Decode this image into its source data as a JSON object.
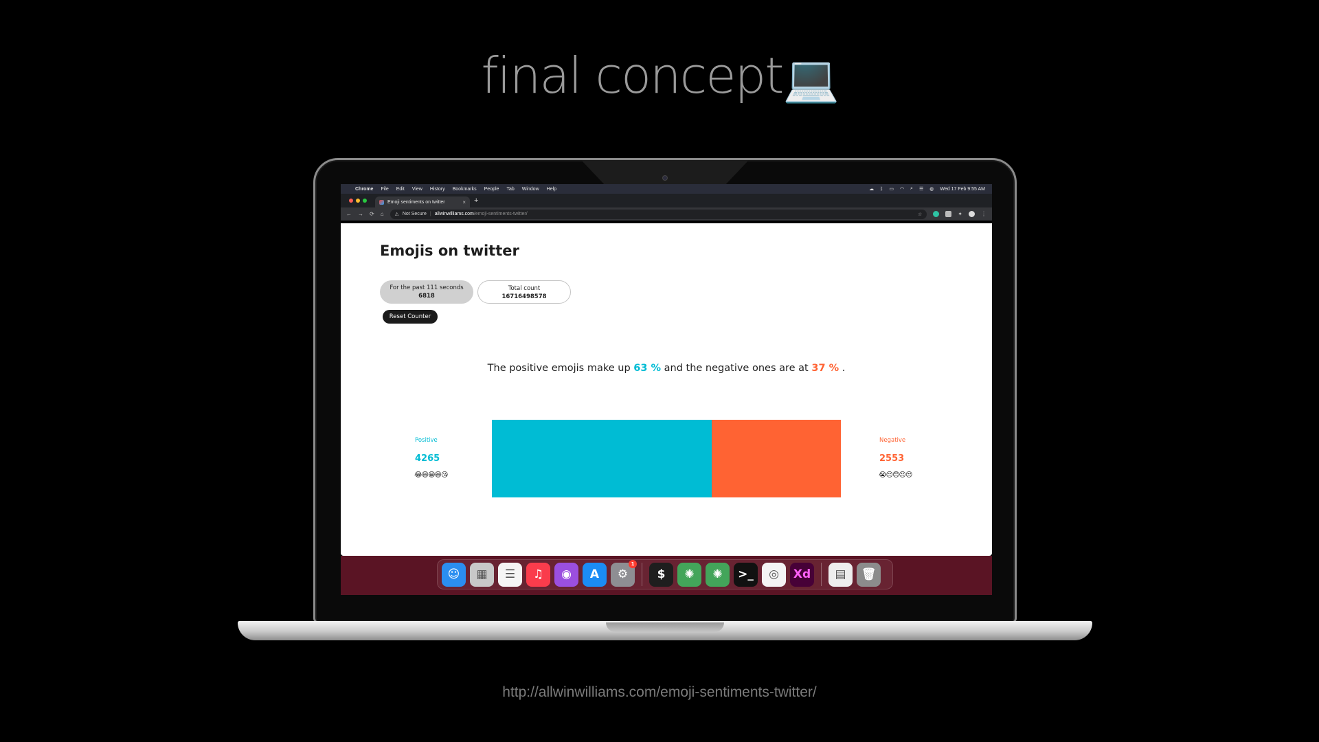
{
  "slide": {
    "title": "final concept",
    "title_emoji": "💻",
    "url": "http://allwinwilliams.com/emoji-sentiments-twitter/"
  },
  "menubar": {
    "apple": "",
    "app": "Chrome",
    "items": [
      "File",
      "Edit",
      "View",
      "History",
      "Bookmarks",
      "People",
      "Tab",
      "Window",
      "Help"
    ],
    "clock": "Wed 17 Feb  9:55 AM"
  },
  "browser": {
    "tab_title": "Emoji sentiments on twitter",
    "tab_close": "×",
    "new_tab": "+",
    "not_secure": "Not Secure",
    "url_host": "allwinwilliams.com",
    "url_path": "/emoji-sentiments-twitter/",
    "back": "←",
    "forward": "→",
    "reload": "⟳",
    "home": "⌂",
    "star": "☆",
    "menu": "⋮"
  },
  "page": {
    "title": "Emojis on twitter",
    "past": {
      "label": "For the past 111 seconds",
      "value": "6818"
    },
    "total": {
      "label": "Total count",
      "value": "16716498578"
    },
    "reset_label": "Reset Counter",
    "summary": {
      "prefix": "The positive emojis make up",
      "positive_pct": "63 %",
      "middle": "and the negative ones are at",
      "negative_pct": "37 %",
      "suffix": "."
    },
    "positive": {
      "label": "Positive",
      "count": "4265",
      "emojis": "😂😄😁😆😘"
    },
    "negative": {
      "label": "Negative",
      "count": "2553",
      "emojis": "😭😔😞😣😒"
    },
    "bar": {
      "positive_fraction": 0.63,
      "negative_fraction": 0.37
    },
    "colors": {
      "positive": "#00bcd4",
      "negative": "#ff6333"
    }
  },
  "dock": {
    "apps": [
      {
        "name": "finder",
        "glyph": "☺",
        "color": "#2b8ef0"
      },
      {
        "name": "launchpad",
        "glyph": "▦",
        "color": "#c8c8c8"
      },
      {
        "name": "reminders",
        "glyph": "☰",
        "color": "#f5f5f5"
      },
      {
        "name": "music",
        "glyph": "♫",
        "color": "#fa3c4c"
      },
      {
        "name": "podcasts",
        "glyph": "◉",
        "color": "#9b4fe0"
      },
      {
        "name": "app-store",
        "glyph": "A",
        "color": "#1b8cf5"
      },
      {
        "name": "system-preferences",
        "glyph": "⚙",
        "color": "#8e8e93",
        "badge": "1"
      },
      {
        "name": "terminal",
        "glyph": "$",
        "color": "#1e1e1e"
      },
      {
        "name": "atom-1",
        "glyph": "✺",
        "color": "#43a55a"
      },
      {
        "name": "atom-2",
        "glyph": "✺",
        "color": "#43a55a"
      },
      {
        "name": "terminal-2",
        "glyph": ">_",
        "color": "#111"
      },
      {
        "name": "chrome",
        "glyph": "◎",
        "color": "#f4f4f4"
      },
      {
        "name": "adobe-xd",
        "glyph": "Xd",
        "color": "#470137"
      },
      {
        "name": "documents",
        "glyph": "▤",
        "color": "#eeeeee"
      },
      {
        "name": "trash",
        "glyph": "🗑",
        "color": "#8c8c8c"
      }
    ]
  }
}
